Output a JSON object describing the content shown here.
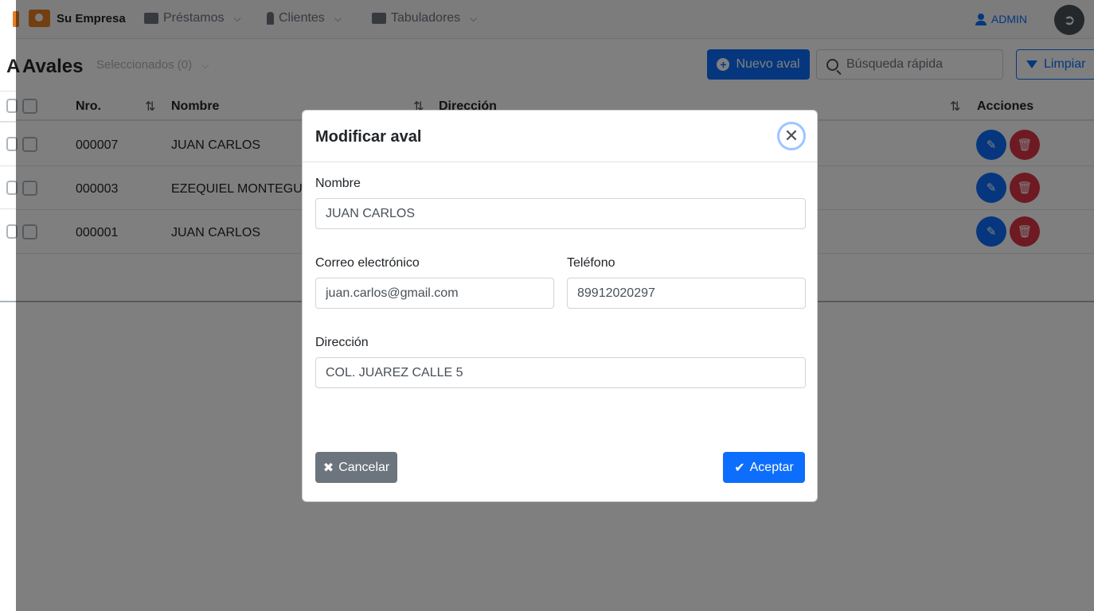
{
  "navbar": {
    "brand": "Su Empresa",
    "menus": [
      {
        "label": "Préstamos"
      },
      {
        "label": "Clientes"
      },
      {
        "label": "Tabuladores"
      }
    ],
    "user": "ADMIN"
  },
  "toolbar": {
    "title": "Avales",
    "ghost_title": "A",
    "selected": "Seleccionados (0)",
    "new_button": "Nuevo aval",
    "search_placeholder": "Búsqueda rápida",
    "clear_button": "Limpiar"
  },
  "table": {
    "columns": [
      "Nro.",
      "Nombre",
      "Dirección",
      "Acciones"
    ],
    "rows": [
      {
        "nro": "000007",
        "nombre": "JUAN CARLOS"
      },
      {
        "nro": "000003",
        "nombre": "EZEQUIEL MONTEGUIA"
      },
      {
        "nro": "000001",
        "nombre": "JUAN CARLOS"
      }
    ]
  },
  "modal": {
    "title": "Modificar aval",
    "fields": {
      "nombre": {
        "label": "Nombre",
        "value": "JUAN CARLOS"
      },
      "correo": {
        "label": "Correo electrónico",
        "value": "juan.carlos@gmail.com"
      },
      "telefono": {
        "label": "Teléfono",
        "value": "89912020297"
      },
      "direccion": {
        "label": "Dirección",
        "value": "COL. JUAREZ CALLE 5"
      }
    },
    "cancel": "Cancelar",
    "accept": "Aceptar"
  },
  "colors": {
    "primary": "#0d6efd",
    "danger": "#dc3545",
    "secondary": "#6c757d",
    "brand": "#e67e22"
  }
}
